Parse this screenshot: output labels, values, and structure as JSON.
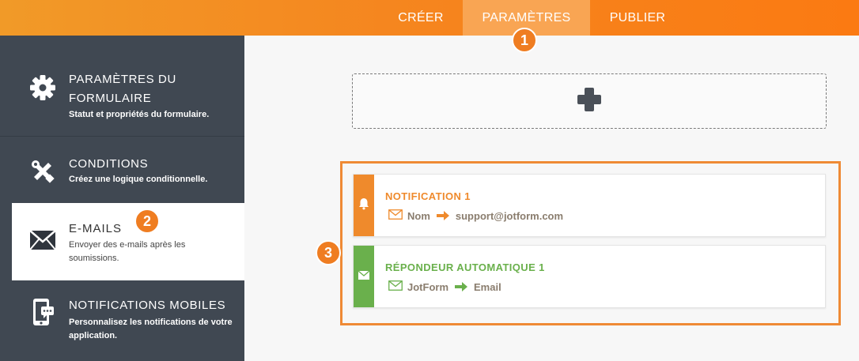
{
  "topnav": {
    "tabs": [
      {
        "label": "CRÉER"
      },
      {
        "label": "PARAMÈTRES"
      },
      {
        "label": "PUBLIER"
      }
    ],
    "active_tab": "PARAMÈTRES"
  },
  "badges": [
    "1",
    "2",
    "3"
  ],
  "sidebar": {
    "items": [
      {
        "title": "PARAMÈTRES DU FORMULAIRE",
        "description": "Statut et propriétés du formulaire.",
        "icon": "gear-icon"
      },
      {
        "title": "CONDITIONS",
        "description": "Créez une logique conditionnelle.",
        "icon": "tools-icon"
      },
      {
        "title": "E-MAILS",
        "description": "Envoyer des e-mails après les soumissions.",
        "icon": "envelope-icon"
      },
      {
        "title": "NOTIFICATIONS MOBILES",
        "description": "Personnalisez les notifications de votre application.",
        "icon": "mobile-notification-icon"
      }
    ],
    "active_item": "E-MAILS"
  },
  "main": {
    "add_icon": "plus-icon",
    "emails": [
      {
        "title": "NOTIFICATION 1",
        "from": "Nom",
        "to": "support@jotform.com",
        "icon": "bell-icon",
        "color": "#ef8a2c"
      },
      {
        "title": "RÉPONDEUR AUTOMATIQUE 1",
        "from": "JotForm",
        "to": "Email",
        "icon": "envelope-icon",
        "color": "#6ab04c"
      }
    ]
  },
  "colors": {
    "accent_orange": "#f5861f",
    "sidebar_bg": "#404852",
    "green": "#6ab04c"
  }
}
